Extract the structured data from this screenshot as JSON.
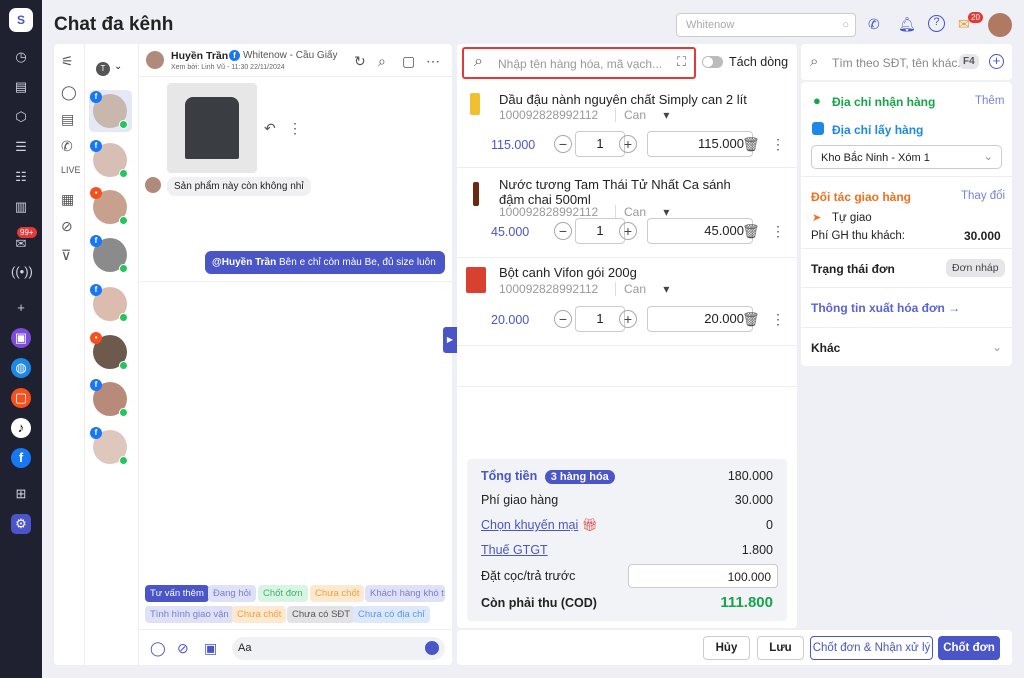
{
  "header": {
    "title": "Chat đa kênh",
    "search_placeholder": "Whitenow",
    "notif_count": "20",
    "sidebar_chat_badge": "99+"
  },
  "chat": {
    "name": "Huyền Trần",
    "page": "Whitenow - Cầu Giấy",
    "viewed_by": "Xem bởi: Linh Vũ - 11:30 22/11/2024",
    "user_filter": "T",
    "incoming": "Sản phẩm này còn không nhỉ",
    "outgoing_mention": "@Huyền Trần",
    "outgoing": "Bên e chỉ còn màu Be, đủ size luôn",
    "tags": [
      "Tư vấn thêm",
      "Đang hỏi",
      "Chốt đơn",
      "Chưa chốt",
      "Khách hàng khó tính",
      "Tình hình giao vận",
      "Chưa chốt",
      "Chưa có SĐT",
      "Chưa có địa chỉ"
    ],
    "input_placeholder": "Aa"
  },
  "order": {
    "search_placeholder": "Nhập tên hàng hóa, mã vạch...",
    "split_label": "Tách dòng",
    "items": [
      {
        "name": "Dầu đậu nành nguyên chất Simply can 2 lít",
        "sku": "100092828992112",
        "unit": "Can",
        "price": "115.000",
        "qty": "1",
        "total": "115.000"
      },
      {
        "name": "Nước tương Tam Thái Tử Nhất Ca sánh đậm chai 500ml",
        "sku": "100092828992112",
        "unit": "Can",
        "price": "45.000",
        "qty": "1",
        "total": "45.000"
      },
      {
        "name": "Bột canh Vifon gói 200g",
        "sku": "100092828992112",
        "unit": "Can",
        "price": "20.000",
        "qty": "1",
        "total": "20.000"
      }
    ],
    "summary": {
      "total_label": "Tổng tiền",
      "count_badge": "3 hàng hóa",
      "total": "180.000",
      "ship_label": "Phí giao hàng",
      "ship": "30.000",
      "promo_label": "Chọn khuyến mại",
      "promo": "0",
      "vat_label": "Thuế GTGT",
      "vat": "1.800",
      "deposit_label": "Đặt cọc/trả trước",
      "deposit": "100.000",
      "cod_label": "Còn phải thu (COD)",
      "cod": "111.800"
    }
  },
  "customer": {
    "search_placeholder": "Tìm theo SĐT, tên khác...",
    "shortcut": "F4",
    "receive_label": "Địa chỉ nhận hàng",
    "add": "Thêm",
    "pickup_label": "Địa chỉ lấy hàng",
    "warehouse": "Kho Bắc Ninh - Xóm 1",
    "partner_label": "Đối tác giao hàng",
    "change": "Thay đổi",
    "partner": "Tự giao",
    "fee_label": "Phí GH thu khách:",
    "fee": "30.000",
    "status_label": "Trạng thái đơn",
    "status": "Đơn nháp",
    "invoice": "Thông tin xuất hóa đơn →",
    "other": "Khác"
  },
  "actions": {
    "cancel": "Hủy",
    "save": "Lưu",
    "confirm_process": "Chốt đơn & Nhận xử lý",
    "confirm": "Chốt đơn"
  }
}
